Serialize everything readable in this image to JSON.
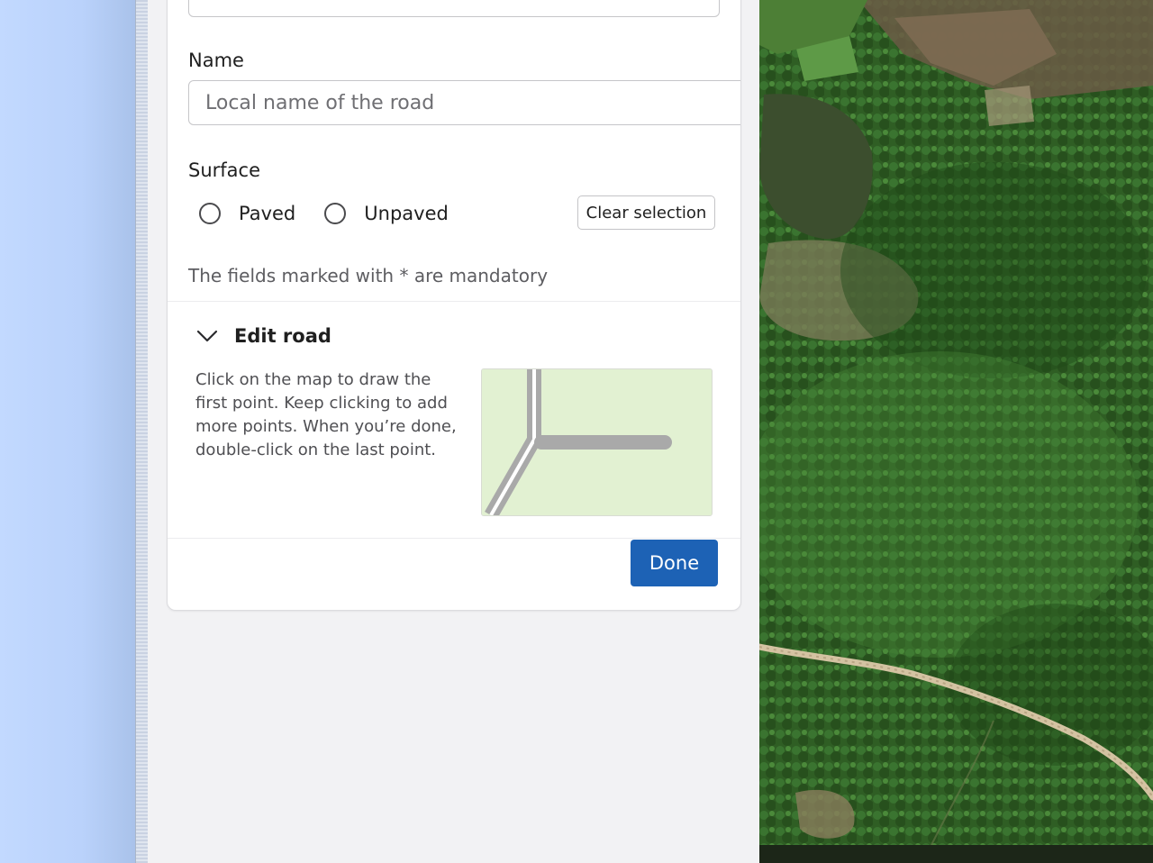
{
  "form": {
    "name_label": "Name",
    "name_placeholder": "Local name of the road",
    "surface_label": "Surface",
    "surface_options": [
      "Paved",
      "Unpaved"
    ],
    "clear_selection": "Clear selection",
    "mandatory_note": "The fields marked with * are mandatory"
  },
  "edit_road": {
    "title": "Edit road",
    "instructions": "Click on the map to draw the first point. Keep clicking to add more points. When you’re done, double-click on the last point."
  },
  "actions": {
    "done": "Done"
  },
  "colors": {
    "primary": "#1d62b5",
    "left_strip": "#bad2fb",
    "illustration_bg": "#e2f1d2",
    "map_track": "#d4c3a2"
  },
  "icons": {
    "collapse": "chevron-down-icon"
  }
}
